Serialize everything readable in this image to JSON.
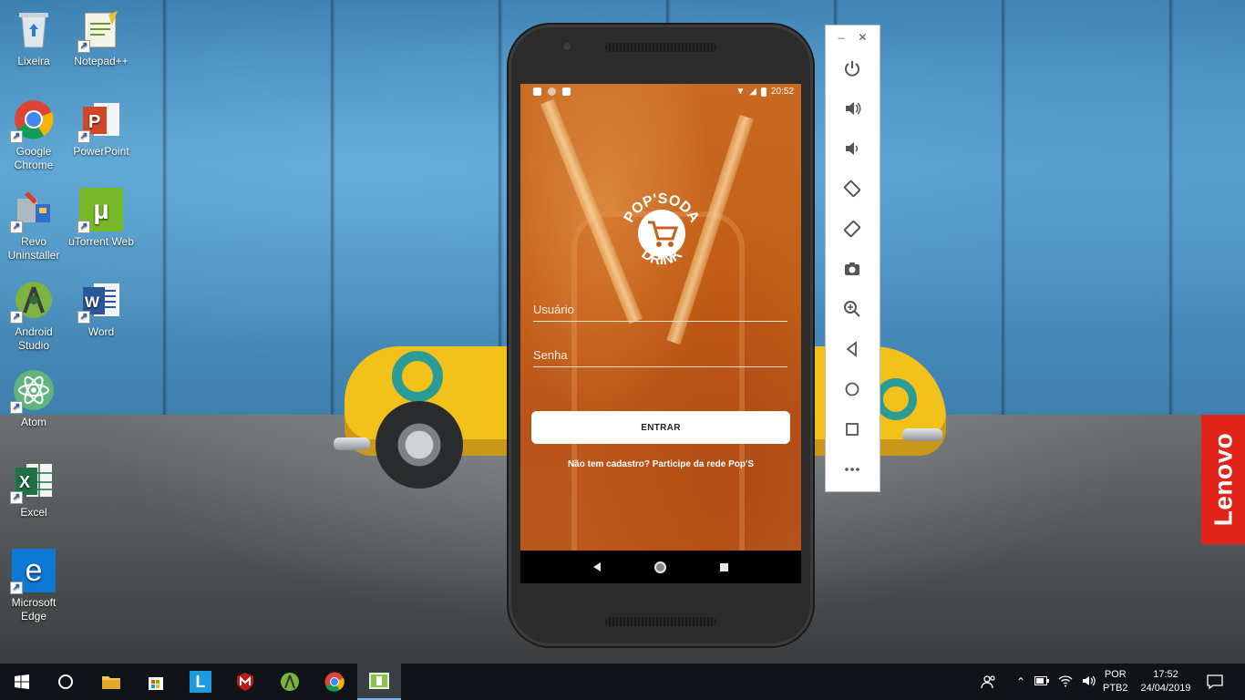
{
  "desktop": {
    "icons": [
      {
        "label": "Lixeira",
        "icon": "recycle-bin-icon"
      },
      {
        "label": "Notepad++",
        "icon": "notepad-plus-plus-icon"
      },
      {
        "label": "Google Chrome",
        "icon": "chrome-icon"
      },
      {
        "label": "PowerPoint",
        "icon": "powerpoint-icon"
      },
      {
        "label": "Revo Uninstaller",
        "icon": "revo-uninstaller-icon"
      },
      {
        "label": "uTorrent Web",
        "icon": "utorrent-icon"
      },
      {
        "label": "Android Studio",
        "icon": "android-studio-icon"
      },
      {
        "label": "Word",
        "icon": "word-icon"
      },
      {
        "label": "Atom",
        "icon": "atom-icon"
      },
      {
        "label": "Excel",
        "icon": "excel-icon"
      },
      {
        "label": "Microsoft Edge",
        "icon": "edge-icon"
      }
    ],
    "lenovo_badge": "Lenovo"
  },
  "emulator": {
    "window_controls": {
      "minimize": "–",
      "close": "✕"
    },
    "toolbar": [
      "power-icon",
      "volume-up-icon",
      "volume-down-icon",
      "rotate-left-icon",
      "rotate-right-icon",
      "camera-icon",
      "zoom-icon",
      "back-icon",
      "home-icon",
      "overview-icon",
      "more-icon"
    ],
    "phone": {
      "status_time": "20:52",
      "logo_top_text": "POP'SODA",
      "logo_bottom_text": "DRINK",
      "username_placeholder": "Usuário",
      "password_placeholder": "Senha",
      "login_button": "ENTRAR",
      "signup_text": "Não tem cadastro? Participe da rede Pop'S"
    }
  },
  "taskbar": {
    "pinned": [
      "start-icon",
      "cortana-icon",
      "file-explorer-icon",
      "store-icon",
      "l-app-icon",
      "mcafee-icon",
      "android-studio-icon",
      "chrome-icon",
      "emulator-icon"
    ],
    "language": "POR",
    "layout": "PTB2",
    "time": "17:52",
    "date": "24/04/2019"
  },
  "colors": {
    "app_orange": "#c4621c",
    "taskbar": "#101418",
    "lenovo_red": "#e2231a"
  }
}
